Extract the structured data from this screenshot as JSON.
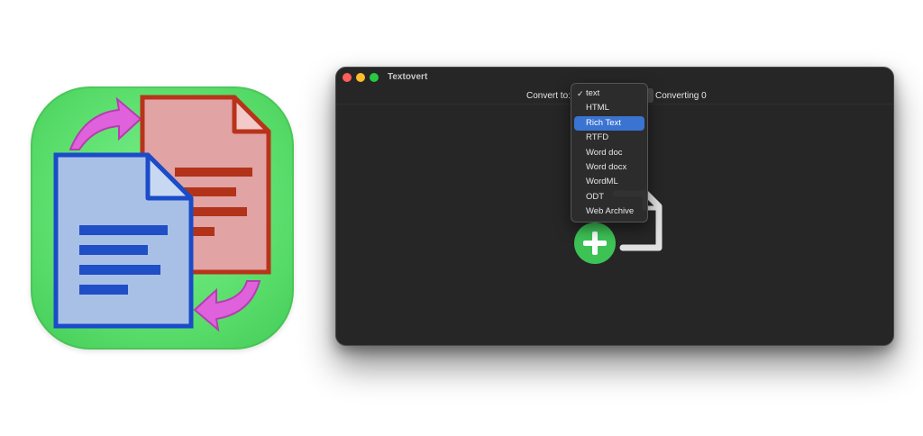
{
  "window": {
    "title": "Textovert"
  },
  "toolbar": {
    "convert_label": "Convert to:",
    "status": "Converting 0"
  },
  "menu": {
    "checkmark": "✓",
    "items": [
      {
        "label": "text",
        "checked": true
      },
      {
        "label": "HTML"
      },
      {
        "label": "Rich Text",
        "highlighted": true
      },
      {
        "label": "RTFD"
      },
      {
        "label": "Word doc"
      },
      {
        "label": "Word docx"
      },
      {
        "label": "WordML"
      },
      {
        "label": "ODT"
      },
      {
        "label": "Web Archive"
      }
    ]
  },
  "colors": {
    "window_bg": "#262626",
    "menu_highlight": "#3a73d1",
    "icon_bg": "#5ee06f",
    "add_badge": "#3dc256",
    "doc_red": "#c0391d",
    "doc_blue": "#1f50c8",
    "arrow_magenta": "#d94fd6"
  },
  "icons": {
    "app_icon": "document-convert-icon",
    "drop_icon": "document-add-icon"
  }
}
